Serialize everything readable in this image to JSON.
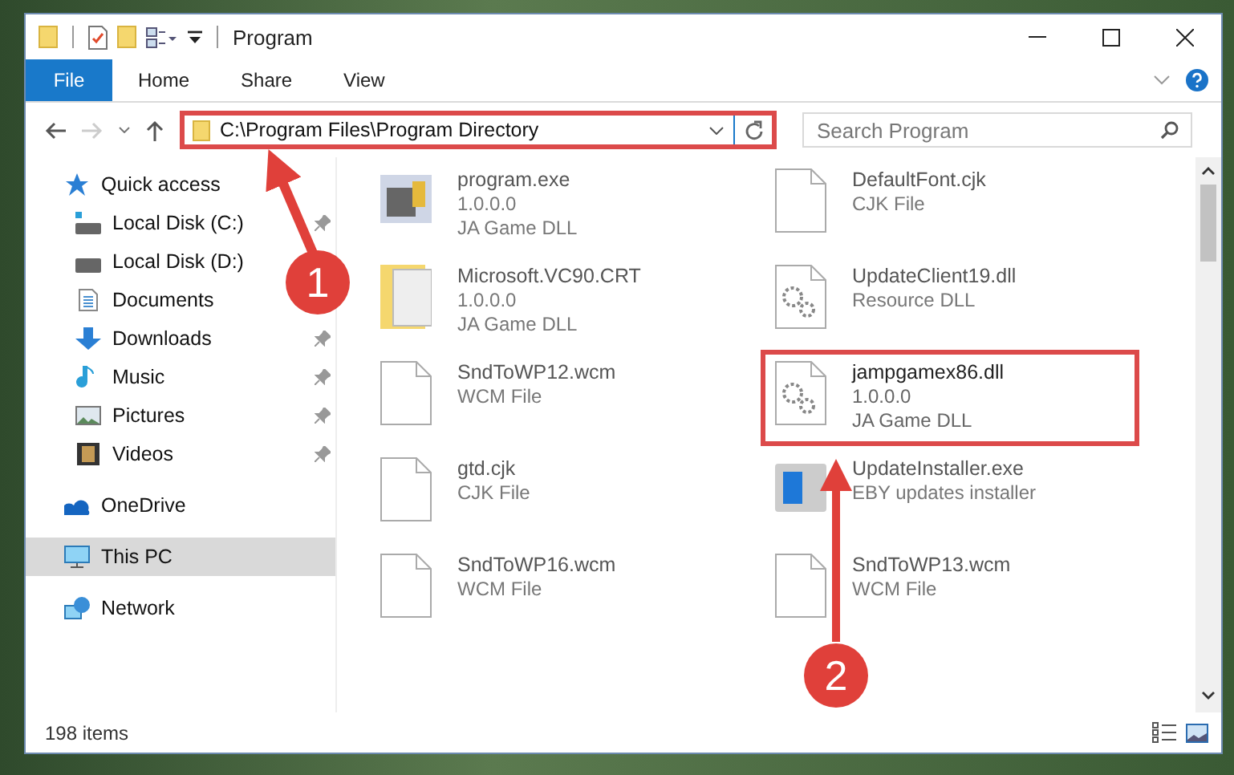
{
  "window": {
    "title": "Program"
  },
  "ribbon_tabs": [
    {
      "label": "File",
      "selected": true
    },
    {
      "label": "Home",
      "selected": false
    },
    {
      "label": "Share",
      "selected": false
    },
    {
      "label": "View",
      "selected": false
    }
  ],
  "address_bar": {
    "value": "C:\\Program Files\\Program Directory",
    "highlighted": true
  },
  "search": {
    "placeholder": "Search Program"
  },
  "sidebar": {
    "items": [
      {
        "label": "Quick access",
        "selected": false,
        "children": [
          {
            "label": "Local Disk (C:)",
            "pinned": true,
            "selected": false
          },
          {
            "label": "Local Disk (D:)",
            "pinned": false,
            "selected": false
          },
          {
            "label": "Documents",
            "pinned": false,
            "selected": false
          },
          {
            "label": "Downloads",
            "pinned": true,
            "selected": false
          },
          {
            "label": "Music",
            "pinned": true,
            "selected": false
          },
          {
            "label": "Pictures",
            "pinned": true,
            "selected": false
          },
          {
            "label": "Videos",
            "pinned": true,
            "selected": false
          }
        ]
      },
      {
        "label": "OneDrive",
        "selected": false
      },
      {
        "label": "This PC",
        "selected": true
      },
      {
        "label": "Network",
        "selected": false
      }
    ]
  },
  "files": [
    {
      "name": "program.exe",
      "details": [
        "1.0.0.0",
        "JA Game DLL"
      ],
      "kind": "exe",
      "highlighted": false
    },
    {
      "name": "DefaultFont.cjk",
      "details": [
        "CJK File"
      ],
      "kind": "blank",
      "highlighted": false
    },
    {
      "name": "Microsoft.VC90.CRT",
      "details": [
        "1.0.0.0",
        "JA Game DLL"
      ],
      "kind": "folder",
      "highlighted": false
    },
    {
      "name": "UpdateClient19.dll",
      "details": [
        "Resource DLL"
      ],
      "kind": "gear",
      "highlighted": false
    },
    {
      "name": "SndToWP12.wcm",
      "details": [
        "WCM File"
      ],
      "kind": "blank",
      "highlighted": false
    },
    {
      "name": "jampgamex86.dll",
      "details": [
        "1.0.0.0",
        "JA Game DLL"
      ],
      "kind": "gear",
      "highlighted": true
    },
    {
      "name": "gtd.cjk",
      "details": [
        "CJK File"
      ],
      "kind": "blank",
      "highlighted": false
    },
    {
      "name": "UpdateInstaller.exe",
      "details": [
        "EBY updates installer"
      ],
      "kind": "installer",
      "highlighted": false
    },
    {
      "name": "SndToWP16.wcm",
      "details": [
        "WCM File"
      ],
      "kind": "blank",
      "highlighted": false
    },
    {
      "name": "SndToWP13.wcm",
      "details": [
        "WCM File"
      ],
      "kind": "blank",
      "highlighted": false
    }
  ],
  "status_bar": {
    "item_count": "198 items"
  },
  "annotations": [
    {
      "number": "1"
    },
    {
      "number": "2"
    }
  ]
}
